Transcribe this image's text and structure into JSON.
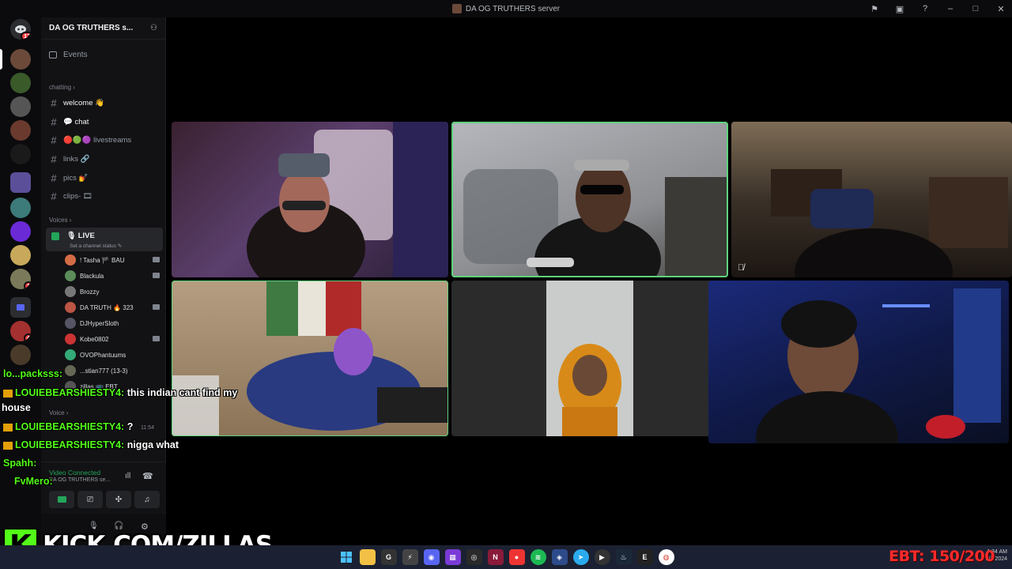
{
  "titlebar": {
    "title": "DA OG TRUTHERS server"
  },
  "server_rail": {
    "home_badge": "17",
    "badges": [
      "1",
      "4"
    ]
  },
  "sidebar": {
    "server_name": "DA OG TRUTHERS s...",
    "events_label": "Events",
    "categories": {
      "chatting": "chatting",
      "voices": "Voices",
      "voice": "Voice"
    },
    "channels": [
      {
        "label": "welcome 👋",
        "unread": true
      },
      {
        "label": "💬 chat",
        "unread": true
      },
      {
        "label": "🔴🟢🟣 livestreams",
        "unread": false
      },
      {
        "label": "links 🔗",
        "unread": false
      },
      {
        "label": "pics 💅",
        "unread": false
      },
      {
        "label": "clips- 🎞",
        "unread": false
      }
    ],
    "voice_channel": {
      "name": "🎙 LIVE",
      "status": "Set a channel status ✎"
    },
    "members": [
      {
        "name": "! Tasha 🏴 BAU",
        "color": "#d36c45"
      },
      {
        "name": "Blackula",
        "color": "#5b8c5a"
      },
      {
        "name": "Brozzy",
        "color": "#777"
      },
      {
        "name": "DA TRUTH 🔥 323",
        "color": "#b54"
      },
      {
        "name": "DJHyperSloth",
        "color": "#556"
      },
      {
        "name": "Kobe0802",
        "color": "#c33"
      },
      {
        "name": "OVOPhantuums",
        "color": "#3a7"
      },
      {
        "name": "...stian777 (13-3)",
        "color": "#665"
      },
      {
        "name": "zillas 📺 EBT",
        "color": "#555"
      }
    ],
    "voice_panel": {
      "status": "Video Connected",
      "server": "DA OG TRUTHERS se..."
    }
  },
  "chat_overlay": [
    {
      "user": "lo...packsss:",
      "message": ""
    },
    {
      "user": "LOUIEBEARSHIESTY4:",
      "message": "this indian cant find my"
    },
    {
      "user": "",
      "message": "house"
    },
    {
      "user": "LOUIEBEARSHIESTY4:",
      "message": "?"
    },
    {
      "user": "LOUIEBEARSHIESTY4:",
      "message": "nigga what"
    },
    {
      "user": "Spahh:",
      "message": ""
    },
    {
      "user": "FvMero:",
      "message": ""
    }
  ],
  "chat_time": "11:54",
  "kick_banner": {
    "logo": "K",
    "text": "KICK.COM/ZILLAS"
  },
  "ebt_overlay": "EBT: 150/200",
  "taskbar": {
    "time": "1:34 AM",
    "date": "1/1/2024"
  },
  "colors": {
    "speaking_outline": "#5fd37c",
    "kick_green": "#53fc18",
    "ebt_red": "#ff2a2a"
  }
}
